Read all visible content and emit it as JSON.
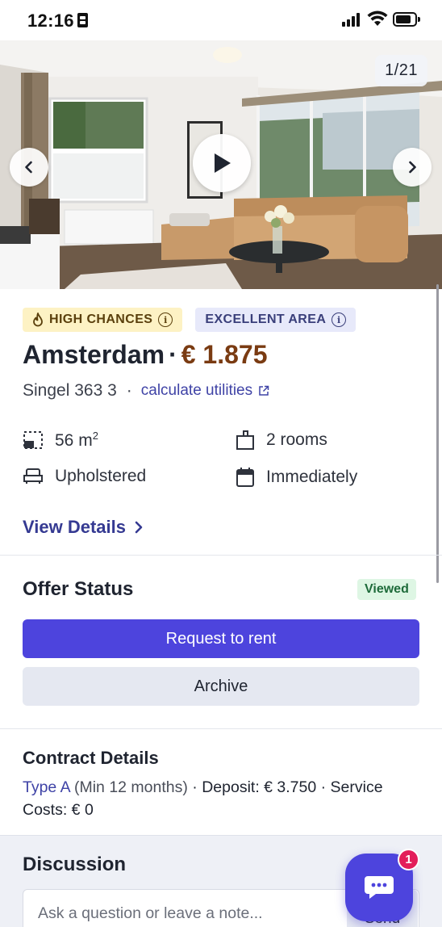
{
  "status_bar": {
    "time": "12:16"
  },
  "gallery": {
    "counter": "1/21"
  },
  "listing": {
    "badges": [
      {
        "label": "HIGH CHANCES",
        "icon": "flame-icon"
      },
      {
        "label": "EXCELLENT AREA",
        "icon": "info-icon"
      }
    ],
    "city": "Amsterdam",
    "separator": "·",
    "price": "€ 1.875",
    "address": "Singel 363 3",
    "address_separator": "·",
    "utilities_link": "calculate utilities",
    "features": {
      "area_value": "56 m",
      "area_unit_sup": "2",
      "rooms": "2 rooms",
      "furnishing": "Upholstered",
      "availability": "Immediately"
    },
    "view_details": "View Details"
  },
  "offer_status": {
    "title": "Offer Status",
    "status_badge": "Viewed",
    "primary_button": "Request to rent",
    "secondary_button": "Archive"
  },
  "contract": {
    "title": "Contract Details",
    "type": "Type A",
    "min": "(Min 12 months)",
    "details": " · Deposit: € 3.750 · Service Costs: € 0"
  },
  "discussion": {
    "title": "Discussion",
    "placeholder": "Ask a question or leave a note...",
    "send_label": "Send",
    "unread_count": "1"
  },
  "colors": {
    "accent": "#4d44dd",
    "price": "#7a3b12",
    "link": "#3f43a6",
    "badge_high_chances_bg": "#fdf2c4",
    "badge_area_bg": "#e7e9fa",
    "viewed_bg": "#def6e4",
    "notification": "#e31d5a"
  }
}
